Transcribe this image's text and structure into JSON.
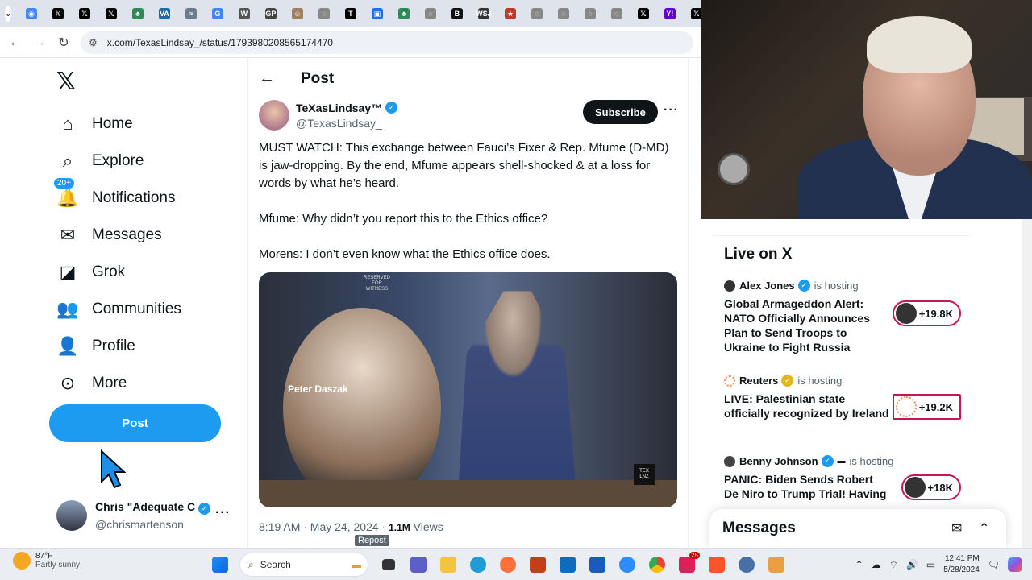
{
  "browser": {
    "url": "x.com/TexasLindsay_/status/1793980208565174470",
    "tabs": [
      {
        "icon": "chrome-icon",
        "color": "#4285f4",
        "glyph": "◉"
      },
      {
        "icon": "x-icon",
        "color": "#000000",
        "glyph": "𝕏"
      },
      {
        "icon": "x-icon",
        "color": "#000000",
        "glyph": "𝕏"
      },
      {
        "icon": "x-icon",
        "color": "#000000",
        "glyph": "𝕏"
      },
      {
        "icon": "tree-icon",
        "color": "#2e8b57",
        "glyph": "♣"
      },
      {
        "icon": "va-icon",
        "color": "#1a6aa8",
        "glyph": "VA"
      },
      {
        "icon": "site-icon",
        "color": "#6b7c8c",
        "glyph": "≈"
      },
      {
        "icon": "g-icon",
        "color": "#4285f4",
        "glyph": "G"
      },
      {
        "icon": "wikipedia-icon",
        "color": "#555555",
        "glyph": "W"
      },
      {
        "icon": "gp-icon",
        "color": "#444444",
        "glyph": "GP"
      },
      {
        "icon": "person-icon",
        "color": "#a08060",
        "glyph": "☺"
      },
      {
        "icon": "globe-icon",
        "color": "#888888",
        "glyph": "◌"
      },
      {
        "icon": "nyt-icon",
        "color": "#000000",
        "glyph": "T"
      },
      {
        "icon": "box-icon",
        "color": "#1a73e8",
        "glyph": "▣"
      },
      {
        "icon": "tree-icon",
        "color": "#2e8b57",
        "glyph": "♣"
      },
      {
        "icon": "globe-icon",
        "color": "#888888",
        "glyph": "◌"
      },
      {
        "icon": "b-icon",
        "color": "#111111",
        "glyph": "B"
      },
      {
        "icon": "wsj-icon",
        "color": "#333333",
        "glyph": "WSJ"
      },
      {
        "icon": "star-icon",
        "color": "#c0392b",
        "glyph": "★"
      },
      {
        "icon": "globe-icon",
        "color": "#888888",
        "glyph": "◌"
      },
      {
        "icon": "globe-icon",
        "color": "#888888",
        "glyph": "◌"
      },
      {
        "icon": "globe-icon",
        "color": "#888888",
        "glyph": "◌"
      },
      {
        "icon": "globe-icon",
        "color": "#888888",
        "glyph": "◌"
      },
      {
        "icon": "x-icon",
        "color": "#000000",
        "glyph": "𝕏"
      },
      {
        "icon": "yahoo-icon",
        "color": "#6001d2",
        "glyph": "Y!"
      },
      {
        "icon": "x-icon",
        "color": "#000000",
        "glyph": "𝕏"
      }
    ]
  },
  "sidebar": {
    "logo": "𝕏",
    "items": [
      {
        "label": "Home",
        "icon": "home-icon",
        "glyph": "⌂"
      },
      {
        "label": "Explore",
        "icon": "search-icon",
        "glyph": "⌕"
      },
      {
        "label": "Notifications",
        "icon": "bell-icon",
        "glyph": "🔔",
        "badge": "20+"
      },
      {
        "label": "Messages",
        "icon": "envelope-icon",
        "glyph": "✉"
      },
      {
        "label": "Grok",
        "icon": "grok-icon",
        "glyph": "◪"
      },
      {
        "label": "Communities",
        "icon": "people-icon",
        "glyph": "👥"
      },
      {
        "label": "Profile",
        "icon": "person-icon",
        "glyph": "👤"
      },
      {
        "label": "More",
        "icon": "more-circle-icon",
        "glyph": "⊙"
      }
    ],
    "post_label": "Post",
    "account": {
      "name": "Chris \"Adequate C",
      "handle": "@chrismartenson"
    }
  },
  "post": {
    "header": "Post",
    "author_name": "TeXasLindsay™",
    "author_handle": "@TexasLindsay_",
    "subscribe_label": "Subscribe",
    "text": "MUST WATCH: This exchange between Fauci’s Fixer & Rep. Mfume (D-MD) is jaw-dropping. By the end, Mfume appears shell-shocked & at a loss for words by what he’s heard.\n\nMfume: Why didn’t you report this to the Ethics office?\n\nMorens: I don’t even know what the Ethics office does.",
    "media_caption": "Peter Daszak",
    "media_sign": "RESERVED\nFOR\nWITNESS",
    "media_watermark": "TEX\nLNZ",
    "time": "8:19 AM · May 24, 2024 · ",
    "views": "1.1M",
    "views_label": " Views",
    "tooltip": "Repost"
  },
  "live": {
    "title": "Live on X",
    "items": [
      {
        "host": "Alex Jones",
        "hosting": "is hosting",
        "title": "Global Armageddon Alert: NATO Officially Announces Plan to Send Troops to Ukraine to Fight Russia",
        "count": "+19.8K"
      },
      {
        "host": "Reuters",
        "hosting": "is hosting",
        "title": "LIVE: Palestinian state officially recognized by Ireland",
        "count": "+19.2K"
      },
      {
        "host": "Benny Johnson",
        "hosting": "is hosting",
        "title": "PANIC: Biden Sends Robert De Niro to Trump Trial! Having a",
        "count": "+18K"
      }
    ]
  },
  "messages_drawer": {
    "title": "Messages"
  },
  "taskbar": {
    "temp": "87°F",
    "weather": "Partly sunny",
    "search": "Search",
    "time": "12:41 PM",
    "date": "5/28/2024",
    "badge": "25"
  },
  "colors": {
    "accent": "#1d9bf0",
    "live_border": "#c2185b"
  }
}
